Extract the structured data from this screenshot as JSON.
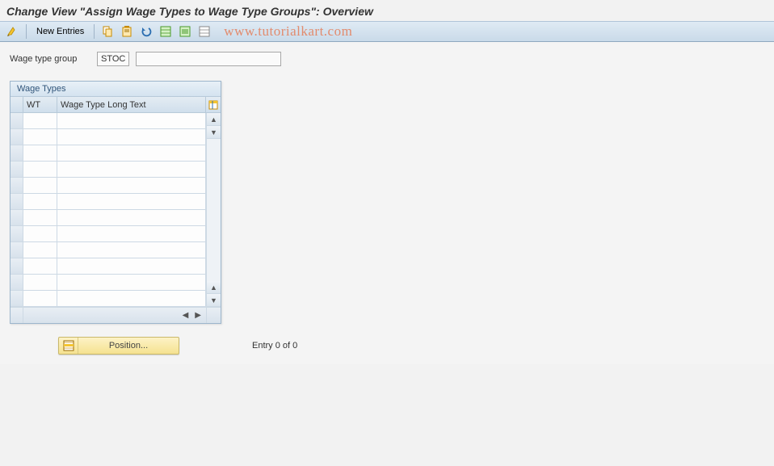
{
  "header": {
    "title": "Change View \"Assign Wage Types to Wage Type Groups\": Overview"
  },
  "toolbar": {
    "new_entries_label": "New Entries",
    "watermark": "www.tutorialkart.com"
  },
  "field": {
    "label": "Wage type group",
    "value_short": "STOC",
    "value_long": ""
  },
  "table": {
    "title": "Wage Types",
    "columns": {
      "wt": "WT",
      "long_text": "Wage Type Long Text"
    },
    "rows": [
      {
        "wt": "",
        "long": ""
      },
      {
        "wt": "",
        "long": ""
      },
      {
        "wt": "",
        "long": ""
      },
      {
        "wt": "",
        "long": ""
      },
      {
        "wt": "",
        "long": ""
      },
      {
        "wt": "",
        "long": ""
      },
      {
        "wt": "",
        "long": ""
      },
      {
        "wt": "",
        "long": ""
      },
      {
        "wt": "",
        "long": ""
      },
      {
        "wt": "",
        "long": ""
      },
      {
        "wt": "",
        "long": ""
      },
      {
        "wt": "",
        "long": ""
      }
    ]
  },
  "footer": {
    "position_label": "Position...",
    "entry_text": "Entry 0 of 0"
  }
}
